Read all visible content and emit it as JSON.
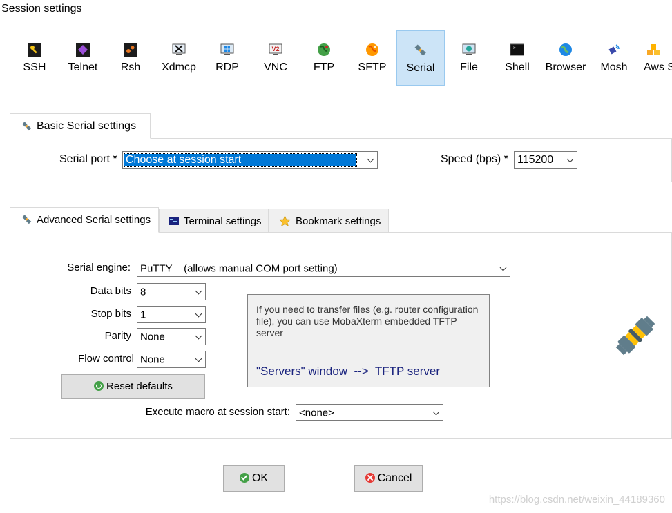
{
  "window": {
    "title": "Session settings"
  },
  "session_types": [
    {
      "label": "SSH",
      "icon": "ssh-key-icon"
    },
    {
      "label": "Telnet",
      "icon": "telnet-icon"
    },
    {
      "label": "Rsh",
      "icon": "rsh-icon"
    },
    {
      "label": "Xdmcp",
      "icon": "xdmcp-icon"
    },
    {
      "label": "RDP",
      "icon": "rdp-icon"
    },
    {
      "label": "VNC",
      "icon": "vnc-icon"
    },
    {
      "label": "FTP",
      "icon": "ftp-globe-icon"
    },
    {
      "label": "SFTP",
      "icon": "sftp-globe-icon"
    },
    {
      "label": "Serial",
      "icon": "serial-plug-icon",
      "active": true
    },
    {
      "label": "File",
      "icon": "file-monitor-icon"
    },
    {
      "label": "Shell",
      "icon": "shell-terminal-icon"
    },
    {
      "label": "Browser",
      "icon": "browser-globe-icon"
    },
    {
      "label": "Mosh",
      "icon": "mosh-satellite-icon"
    },
    {
      "label": "Aws S",
      "icon": "aws-cubes-icon"
    }
  ],
  "basic": {
    "tab_label": "Basic Serial settings",
    "serial_port_label": "Serial port *",
    "serial_port_value": "Choose at session start",
    "speed_label": "Speed (bps) *",
    "speed_value": "115200"
  },
  "advanced_tabs": [
    {
      "label": "Advanced Serial settings",
      "active": true
    },
    {
      "label": "Terminal settings"
    },
    {
      "label": "Bookmark settings"
    }
  ],
  "advanced": {
    "engine_label": "Serial engine:",
    "engine_value": "PuTTY    (allows manual COM port setting)",
    "data_bits_label": "Data bits",
    "data_bits_value": "8",
    "stop_bits_label": "Stop bits",
    "stop_bits_value": "1",
    "parity_label": "Parity",
    "parity_value": "None",
    "flow_label": "Flow control",
    "flow_value": "None",
    "reset_label": "Reset defaults",
    "info_text": "If you need to transfer files (e.g. router configuration file), you can use MobaXterm embedded TFTP server",
    "info_link": "\"Servers\" window  -->  TFTP server",
    "macro_label": "Execute macro at session start:",
    "macro_value": "<none>"
  },
  "footer": {
    "ok_label": "OK",
    "cancel_label": "Cancel"
  },
  "watermark": "https://blog.csdn.net/weixin_44189360",
  "colors": {
    "selection": "#0078d7",
    "active_tab": "#cce4f7",
    "link": "#1a237e"
  }
}
